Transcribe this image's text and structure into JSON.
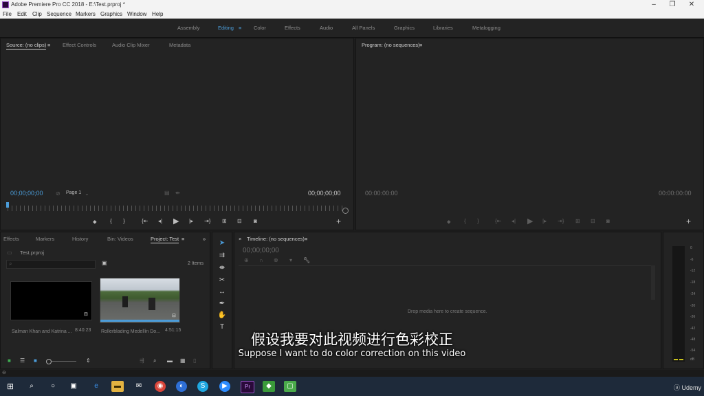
{
  "window": {
    "title": "Adobe Premiere Pro CC 2018 - E:\\Test.prproj *"
  },
  "menu": [
    "File",
    "Edit",
    "Clip",
    "Sequence",
    "Markers",
    "Graphics",
    "Window",
    "Help"
  ],
  "workspaces": {
    "items": [
      "Assembly",
      "Editing",
      "Color",
      "Effects",
      "Audio",
      "All Panels",
      "Graphics",
      "Libraries",
      "Metalogging"
    ],
    "active": "Editing"
  },
  "source": {
    "tabs": [
      "Source: (no clips)",
      "Effect Controls",
      "Audio Clip Mixer",
      "Metadata"
    ],
    "timecode_left": "00;00;00;00",
    "page": "Page 1",
    "timecode_right": "00;00;00;00"
  },
  "program": {
    "tab": "Program: (no sequences)",
    "timecode_left": "00:00:00:00",
    "timecode_right": "00:00:00:00"
  },
  "project": {
    "tabs": [
      "Effects",
      "Markers",
      "History",
      "Bin: Videos",
      "Project: Test"
    ],
    "file": "Test.prproj",
    "count": "2 Items",
    "clips": [
      {
        "name": "Salman Khan and Katrina ...",
        "duration": "8:40:23"
      },
      {
        "name": "Rollerblading Medellín Do...",
        "duration": "4:51:15"
      }
    ]
  },
  "timeline": {
    "tab": "Timeline: (no sequences)",
    "timecode": "00;00;00;00",
    "drop_text": "Drop media here to create sequence."
  },
  "meter_ticks": [
    "0",
    "-6",
    "-12",
    "-18",
    "-24",
    "-30",
    "-36",
    "-42",
    "-48",
    "-54",
    "dB"
  ],
  "subtitle": {
    "cn": "假设我要对此视频进行色彩校正",
    "en": "Suppose I want to do color correction on this video"
  },
  "taskbar": {
    "brand": "Udemy"
  },
  "colors": {
    "accent": "#4b9cd9",
    "panel": "#232323",
    "premiere_purple": "#9a55c9"
  }
}
